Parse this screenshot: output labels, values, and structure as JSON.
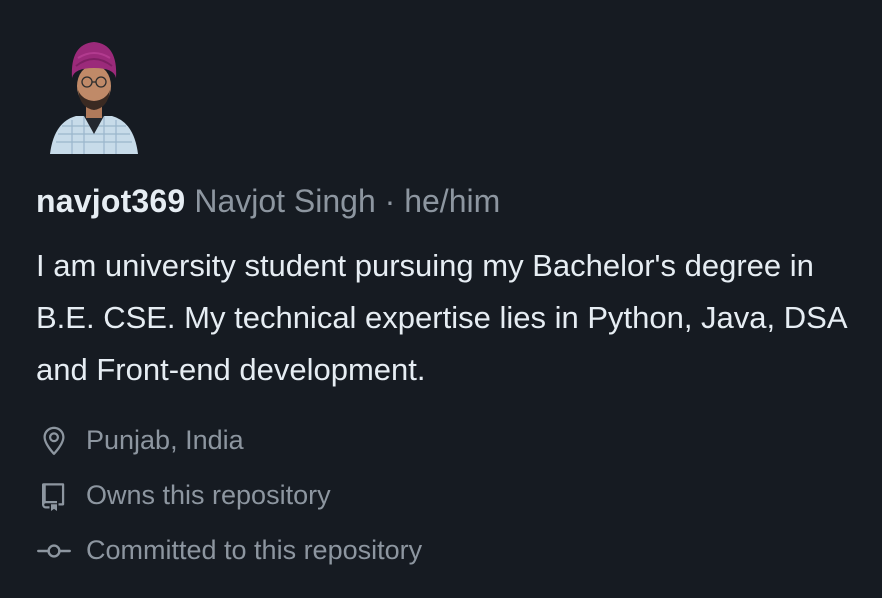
{
  "user": {
    "login": "navjot369",
    "name": "Navjot Singh",
    "separator": "·",
    "pronouns": "he/him",
    "avatar_icon": "user-avatar-photo"
  },
  "bio": "I am university student pursuing my Bachelor's degree in B.E. CSE. My technical expertise lies in Python, Java, DSA and Front-end development.",
  "meta": [
    {
      "icon": "location-icon",
      "label": "Punjab, India"
    },
    {
      "icon": "repo-icon",
      "label": "Owns this repository"
    },
    {
      "icon": "commit-icon",
      "label": "Committed to this repository"
    }
  ],
  "colors": {
    "background": "#161b22",
    "primary_text": "#e6edf3",
    "muted_text": "#8d96a0",
    "turban": "#9b2a7a"
  }
}
